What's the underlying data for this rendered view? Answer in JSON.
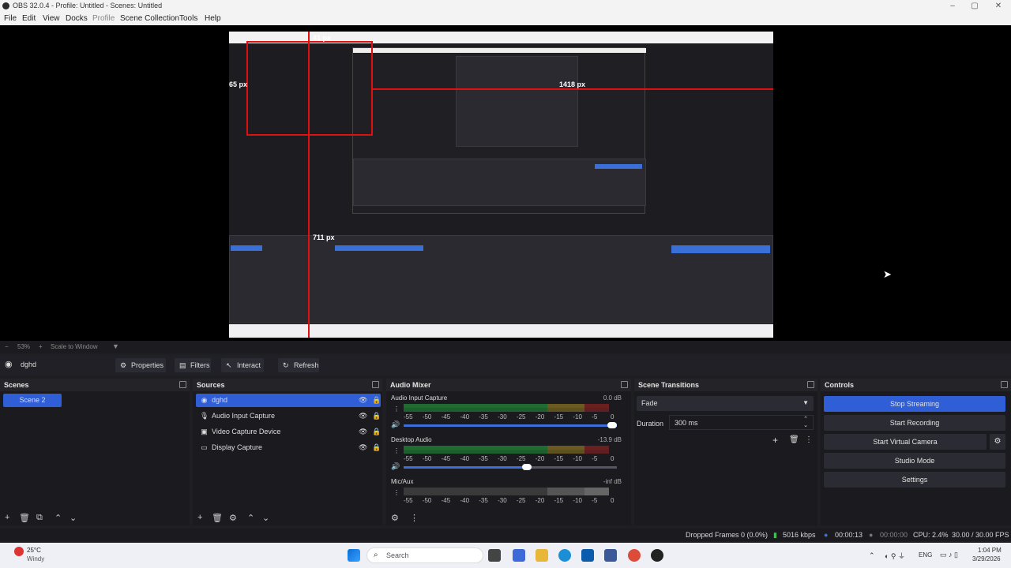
{
  "window": {
    "title": "OBS 32.0.4 - Profile: Untitled - Scenes: Untitled"
  },
  "menu": [
    "File",
    "Edit",
    "View",
    "Docks",
    "Profile",
    "Scene Collection",
    "Tools",
    "Help"
  ],
  "preview": {
    "overlay_labels": {
      "top": "41 px",
      "left": "65 px",
      "right": "1418 px",
      "bottom": "711 px"
    }
  },
  "zoom": {
    "percent": "53%",
    "mode": "Scale to Window"
  },
  "source_toolbar": {
    "selected_source": "dghd",
    "properties": "Properties",
    "filters": "Filters",
    "interact": "Interact",
    "refresh": "Refresh"
  },
  "docks": {
    "scenes": {
      "title": "Scenes",
      "items": [
        "Scene 2"
      ]
    },
    "sources": {
      "title": "Sources",
      "items": [
        {
          "name": "dghd",
          "icon": "browser-icon"
        },
        {
          "name": "Audio Input Capture",
          "icon": "mic-icon"
        },
        {
          "name": "Video Capture Device",
          "icon": "camera-icon"
        },
        {
          "name": "Display Capture",
          "icon": "monitor-icon"
        }
      ]
    },
    "audio_mixer": {
      "title": "Audio Mixer",
      "channels": [
        {
          "name": "Audio Input Capture",
          "db": "0.0 dB",
          "volume": 1.0
        },
        {
          "name": "Desktop Audio",
          "db": "-13.9 dB",
          "volume": 0.6
        },
        {
          "name": "Mic/Aux",
          "db": "-inf dB",
          "volume": 0.0
        }
      ],
      "scale_labels": [
        "-55",
        "-50",
        "-45",
        "-40",
        "-35",
        "-30",
        "-25",
        "-20",
        "-15",
        "-10",
        "-5",
        "0"
      ]
    },
    "scene_transitions": {
      "title": "Scene Transitions",
      "transition": "Fade",
      "duration_label": "Duration",
      "duration": "300 ms"
    },
    "controls": {
      "title": "Controls",
      "buttons": [
        "Stop Streaming",
        "Start Recording",
        "Start Virtual Camera",
        "Studio Mode",
        "Settings"
      ]
    }
  },
  "status": {
    "dropped_frames": "Dropped Frames 0 (0.0%)",
    "bitrate": "5016 kbps",
    "stream_time": "00:00:13",
    "rec_time": "00:00:00",
    "cpu": "CPU: 2.4%",
    "fps": "30.00 / 30.00 FPS"
  },
  "taskbar": {
    "weather_temp": "25°C",
    "weather_desc": "Windy",
    "search_placeholder": "Search",
    "lang": "ENG",
    "time": "1:04 PM",
    "date": "3/29/2026"
  },
  "colors": {
    "accent": "#2f5ed6",
    "record_red": "#e01010",
    "bg": "#1b1b1f"
  }
}
